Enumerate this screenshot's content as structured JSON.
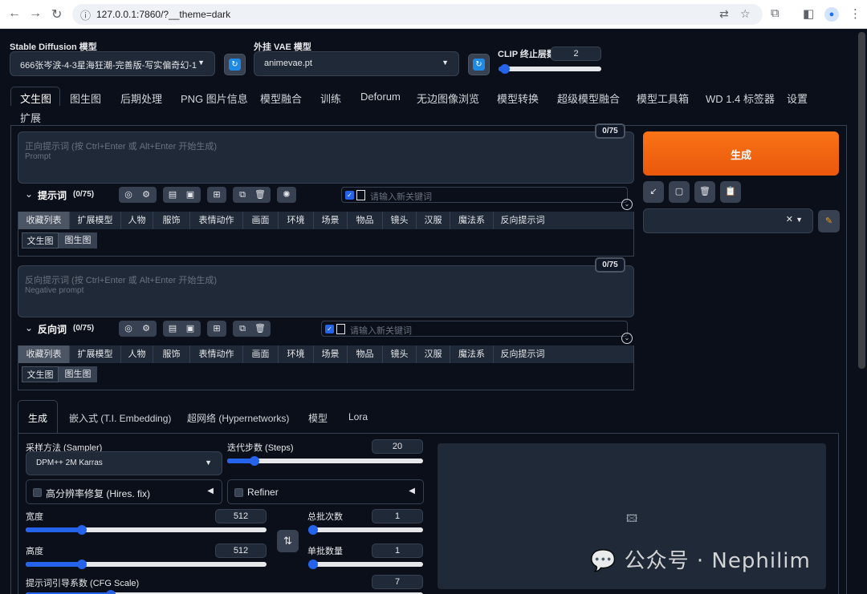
{
  "browser": {
    "url": "127.0.0.1:7860/?__theme=dark"
  },
  "top": {
    "sd_model_label": "Stable Diffusion 模型",
    "sd_model_value": "666张岑涙-4-3星海狂潮-完善版-写实偏奇幻-1.",
    "vae_label": "外挂 VAE 模型",
    "vae_value": "animevae.pt",
    "clip_label": "CLIP 终止层数",
    "clip_value": "2"
  },
  "tabs": [
    "文生图",
    "图生图",
    "后期处理",
    "PNG 图片信息",
    "模型融合",
    "训练",
    "Deforum",
    "无边图像浏览",
    "模型转换",
    "超级模型融合",
    "模型工具箱",
    "WD 1.4 标签器",
    "设置",
    "扩展"
  ],
  "prompt": {
    "placeholder_cn": "正向提示词 (按 Ctrl+Enter 或 Alt+Enter 开始生成)",
    "placeholder_en": "Prompt",
    "counter": "0/75",
    "section_label": "提示词",
    "section_count": "(0/75)",
    "kw_placeholder": "请输入新关键词"
  },
  "negative": {
    "placeholder_cn": "反向提示词 (按 Ctrl+Enter 或 Alt+Enter 开始生成)",
    "placeholder_en": "Negative prompt",
    "counter": "0/75",
    "section_label": "反向词",
    "section_count": "(0/75)",
    "kw_placeholder": "请输入新关键词"
  },
  "categories": [
    "收藏列表",
    "扩展模型",
    "人物",
    "服饰",
    "表情动作",
    "画面",
    "环境",
    "场景",
    "物品",
    "镜头",
    "汉服",
    "魔法系",
    "反向提示词"
  ],
  "subtabs": [
    "文生图",
    "图生图"
  ],
  "generate": {
    "label": "生成"
  },
  "settings_tabs": [
    "生成",
    "嵌入式 (T.I. Embedding)",
    "超网络 (Hypernetworks)",
    "模型",
    "Lora"
  ],
  "params": {
    "sampler_label": "采样方法 (Sampler)",
    "sampler_value": "DPM++ 2M Karras",
    "steps_label": "迭代步数 (Steps)",
    "steps_value": "20",
    "hires_label": "高分辨率修复 (Hires. fix)",
    "refiner_label": "Refiner",
    "width_label": "宽度",
    "width_value": "512",
    "height_label": "高度",
    "height_value": "512",
    "batch_count_label": "总批次数",
    "batch_count_value": "1",
    "batch_size_label": "单批数量",
    "batch_size_value": "1",
    "cfg_label": "提示词引导系数 (CFG Scale)",
    "cfg_value": "7"
  },
  "watermark": "公众号 · Nephilim",
  "colors": {
    "background": "#0b0f19",
    "accent": "#ea580c",
    "slider": "#2563eb"
  }
}
